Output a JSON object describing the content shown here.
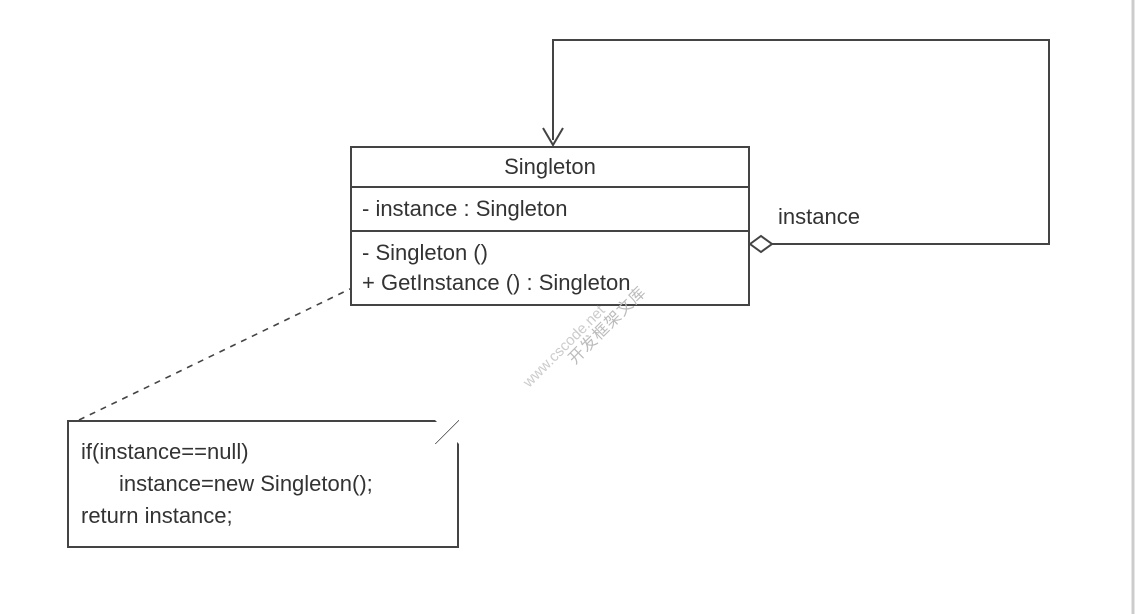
{
  "uml": {
    "className": "Singleton",
    "attributes": [
      {
        "text": "- instance  :  Singleton"
      }
    ],
    "operations": [
      {
        "text": "-   Singleton ()"
      },
      {
        "text": "+  GetInstance () : Singleton"
      }
    ],
    "association": {
      "label": "instance"
    }
  },
  "note": {
    "line1": "if(instance==null)",
    "line2": "instance=new Singleton();",
    "line3": "return instance;"
  },
  "watermark": {
    "text1": "开发框架文库",
    "text2": "www.cscode.net"
  }
}
